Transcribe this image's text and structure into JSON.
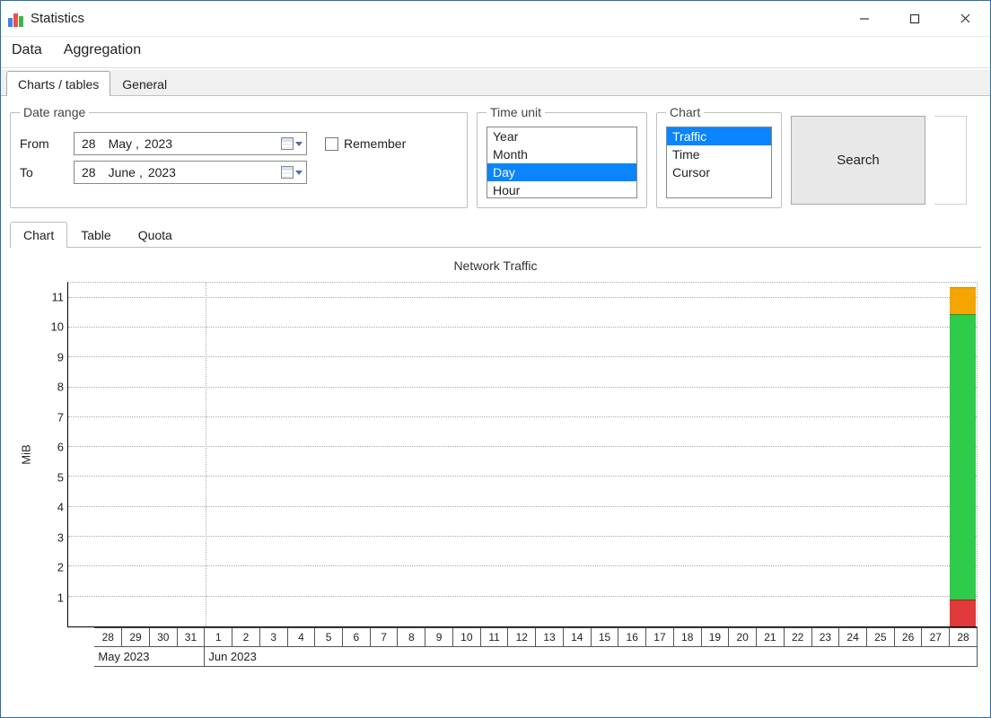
{
  "window": {
    "title": "Statistics"
  },
  "menu": {
    "items": [
      "Data",
      "Aggregation"
    ]
  },
  "main_tabs": {
    "items": [
      "Charts / tables",
      "General"
    ],
    "active": 0
  },
  "date_range": {
    "legend": "Date range",
    "from_label": "From",
    "to_label": "To",
    "from": {
      "day": "28",
      "month": "May",
      "year": "2023"
    },
    "to": {
      "day": "28",
      "month": "June",
      "year": "2023"
    },
    "remember_label": "Remember",
    "remember_checked": false
  },
  "time_unit": {
    "legend": "Time unit",
    "items": [
      "Year",
      "Month",
      "Day",
      "Hour"
    ],
    "selected": 2
  },
  "chart_type": {
    "legend": "Chart",
    "items": [
      "Traffic",
      "Time",
      "Cursor"
    ],
    "selected": 0
  },
  "search_button": "Search",
  "sub_tabs": {
    "items": [
      "Chart",
      "Table",
      "Quota"
    ],
    "active": 0
  },
  "chart_data": {
    "type": "bar",
    "title": "Network Traffic",
    "ylabel": "MiB",
    "xlabel": "",
    "ylim": [
      0,
      11.5
    ],
    "yticks": [
      1,
      2,
      3,
      4,
      5,
      6,
      7,
      8,
      9,
      10,
      11
    ],
    "month_sections": [
      {
        "label": "May 2023",
        "days": [
          "28",
          "29",
          "30",
          "31"
        ]
      },
      {
        "label": "Jun 2023",
        "days": [
          "1",
          "2",
          "3",
          "4",
          "5",
          "6",
          "7",
          "8",
          "9",
          "10",
          "11",
          "12",
          "13",
          "14",
          "15",
          "16",
          "17",
          "18",
          "19",
          "20",
          "21",
          "22",
          "23",
          "24",
          "25",
          "26",
          "27",
          "28"
        ]
      }
    ],
    "series": [
      {
        "name": "red",
        "color": "#e03a3a"
      },
      {
        "name": "green",
        "color": "#2fcb4a"
      },
      {
        "name": "orange",
        "color": "#f5a500"
      }
    ],
    "stacks": [
      {
        "section": 1,
        "day": "28",
        "segments": {
          "red": 0.9,
          "green": 9.5,
          "orange": 0.9
        }
      }
    ]
  }
}
